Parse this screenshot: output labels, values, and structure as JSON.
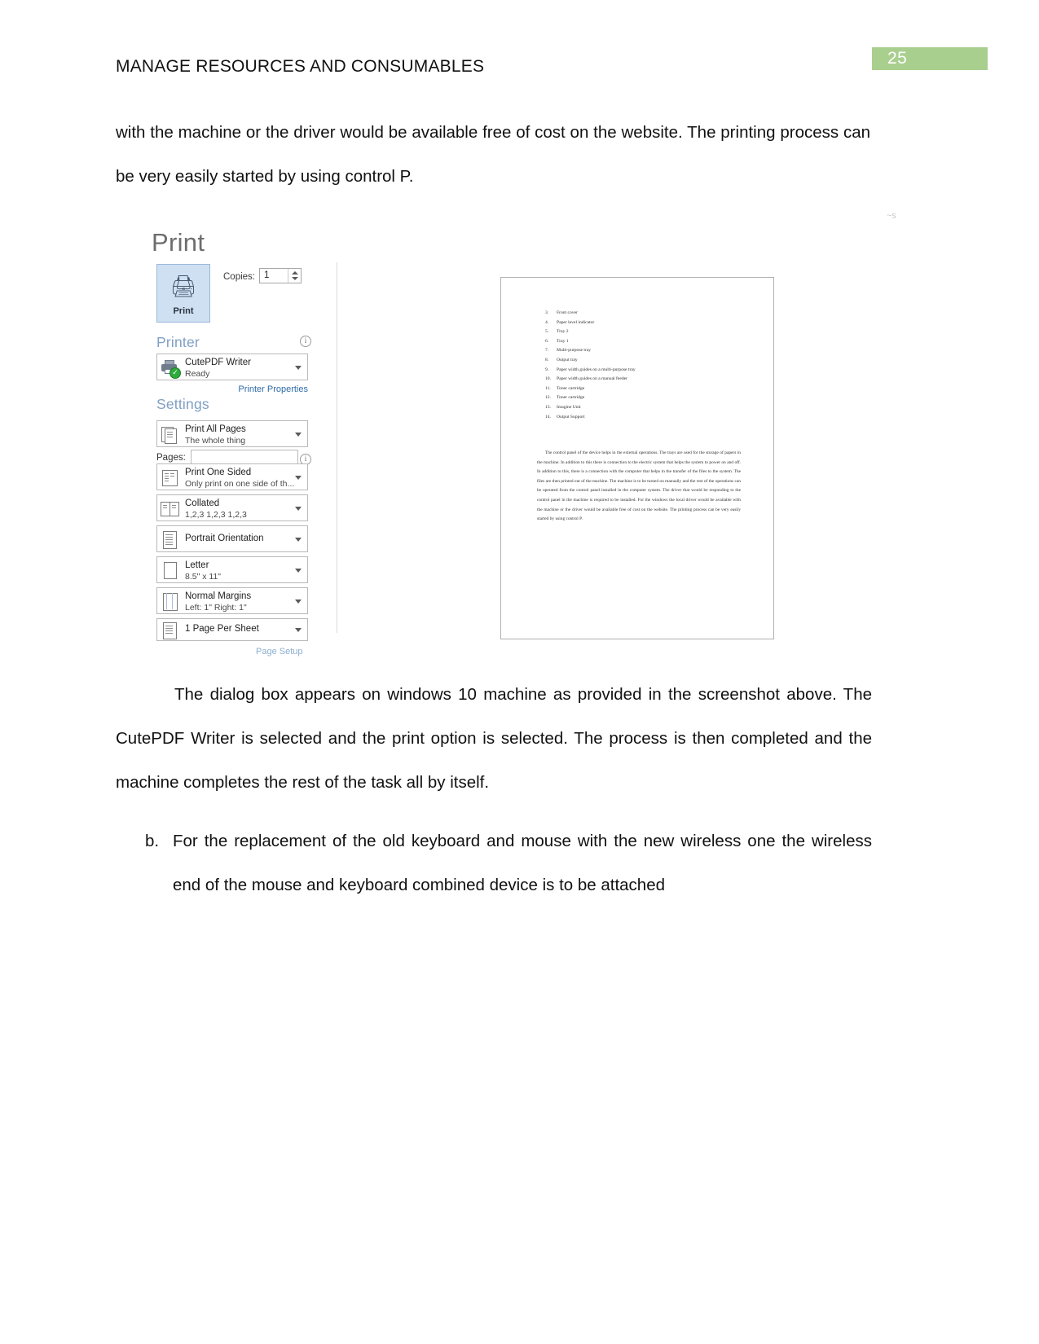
{
  "page": {
    "number": "25",
    "header": "MANAGE RESOURCES AND CONSUMABLES",
    "artifact": "~s"
  },
  "body": {
    "intro_paragraph": "with the machine or the driver would be available free of cost on the website. The printing process can be very easily started by using control P.",
    "after_paragraph": "The dialog box appears on windows 10 machine as provided in the screenshot above.  The CutePDF Writer is selected and the print option is selected. The process is then completed and the machine completes the rest of the task all by itself.",
    "list_item_marker": "b.",
    "list_item_text": "For the replacement of the old keyboard and mouse with the new wireless one the wireless end of the mouse and keyboard combined device is to be attached"
  },
  "print_dialog": {
    "title": "Print",
    "print_button_label": "Print",
    "print_icon": "printer-icon",
    "copies_label": "Copies:",
    "copies_value": "1",
    "printer_section": "Printer",
    "printer_name": "CutePDF Writer",
    "printer_status": "Ready",
    "printer_icon": "printer-status-icon",
    "printer_properties_link": "Printer Properties",
    "settings_section": "Settings",
    "pages_label": "Pages:",
    "pages_value": "",
    "page_setup_link": "Page Setup",
    "info_icon": "i",
    "settings": [
      {
        "icon": "all-pages-icon",
        "primary": "Print All Pages",
        "secondary": "The whole thing"
      },
      {
        "icon": "one-sided-icon",
        "primary": "Print One Sided",
        "secondary": "Only print on one side of th..."
      },
      {
        "icon": "collated-icon",
        "primary": "Collated",
        "secondary": "1,2,3   1,2,3   1,2,3"
      },
      {
        "icon": "portrait-icon",
        "primary": "Portrait Orientation",
        "secondary": ""
      },
      {
        "icon": "paper-size-icon",
        "primary": "Letter",
        "secondary": "8.5\" x 11\""
      },
      {
        "icon": "margins-icon",
        "primary": "Normal Margins",
        "secondary": "Left:  1\"    Right:  1\""
      },
      {
        "icon": "pages-per-sheet-icon",
        "primary": "1 Page Per Sheet",
        "secondary": ""
      }
    ],
    "preview": {
      "list": [
        {
          "num": "3.",
          "text": "Front cover"
        },
        {
          "num": "4.",
          "text": "Paper level indicator"
        },
        {
          "num": "5.",
          "text": "Tray 2"
        },
        {
          "num": "6.",
          "text": "Tray 1"
        },
        {
          "num": "7.",
          "text": "Multi-purpose tray"
        },
        {
          "num": "8.",
          "text": "Output tray"
        },
        {
          "num": "9.",
          "text": "Paper width guides on a multi-purpose tray"
        },
        {
          "num": "10.",
          "text": "Paper width guides on a manual feeder"
        },
        {
          "num": "11.",
          "text": "Toner cartridge"
        },
        {
          "num": "12.",
          "text": "Toner cartridge"
        },
        {
          "num": "13.",
          "text": "Imagine Unit"
        },
        {
          "num": "14.",
          "text": "Output Support"
        }
      ],
      "paragraph": "The control panel of the device helps in the external operations. The trays are used for the storage of papers in the machine. In addition to this there is connection to the electric system that helps the system to power on and off. In addition to this, there is a connection with the computer that helps in the transfer of the files to the system. The files are then printed out of the machine. The machine is to be turned on manually and the rest of the operations can be operated from the control panel installed in the computer system. The driver that would be responding to the control panel in the machine is required to be installed. For the windows the local driver would be available with the machine or the driver would be available free of cost on the website. The printing process can be very easily started by using control P."
    }
  },
  "colors": {
    "page_badge_bg": "#a9cf8e",
    "section_head": "#7f9fc4",
    "link": "#2e6da8",
    "print_button_bg": "#cfe0f2",
    "status_ok": "#2eab3c"
  }
}
